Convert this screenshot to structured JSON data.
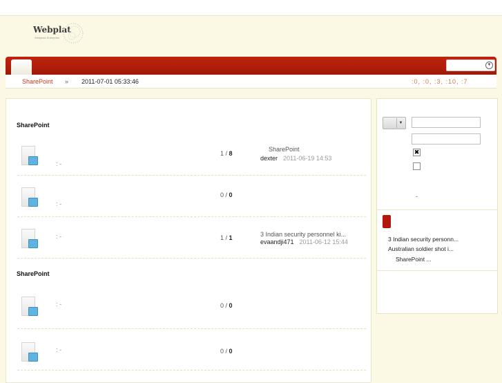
{
  "header": {
    "logo_text": "Webplat",
    "logo_subtitle": "Webplatz Enterprise"
  },
  "subbar": {
    "breadcrumb": "SharePoint",
    "separator": "»",
    "datetime": "2011-07-01 05:33:46",
    "stats": ":0, :0, :3, :10, :7"
  },
  "main": {
    "section1_title": "SharePoint",
    "section2_title": "SharePoint",
    "rows": [
      {
        "meta": ": -",
        "count_a": "1",
        "count_b": "8",
        "last_title": "SharePoint",
        "last_user": "dexter",
        "last_time": "2011-06-19 14:53"
      },
      {
        "meta": ": -",
        "count_a": "0",
        "count_b": "0",
        "last_title": "",
        "last_user": "",
        "last_time": ""
      },
      {
        "meta": ": -",
        "count_a": "1",
        "count_b": "1",
        "last_title": "3 Indian security personnel ki...",
        "last_user": "evaandji471",
        "last_time": "2011-06-12 15:44"
      },
      {
        "meta": ": -",
        "count_a": "0",
        "count_b": "0",
        "last_title": "",
        "last_user": "",
        "last_time": ""
      },
      {
        "meta": ": -",
        "count_a": "0",
        "count_b": "0",
        "last_title": "",
        "last_user": "",
        "last_time": ""
      }
    ]
  },
  "sidebar": {
    "dash": "-",
    "checkbox1_checked": "✖",
    "links": [
      "3 Indian security personn...",
      "Australian soldier shot i...",
      "SharePoint ..."
    ]
  },
  "colors": {
    "nav_red": "#b3170c",
    "accent_orange": "#c23a1c",
    "page_bg": "#fbf8e4"
  }
}
